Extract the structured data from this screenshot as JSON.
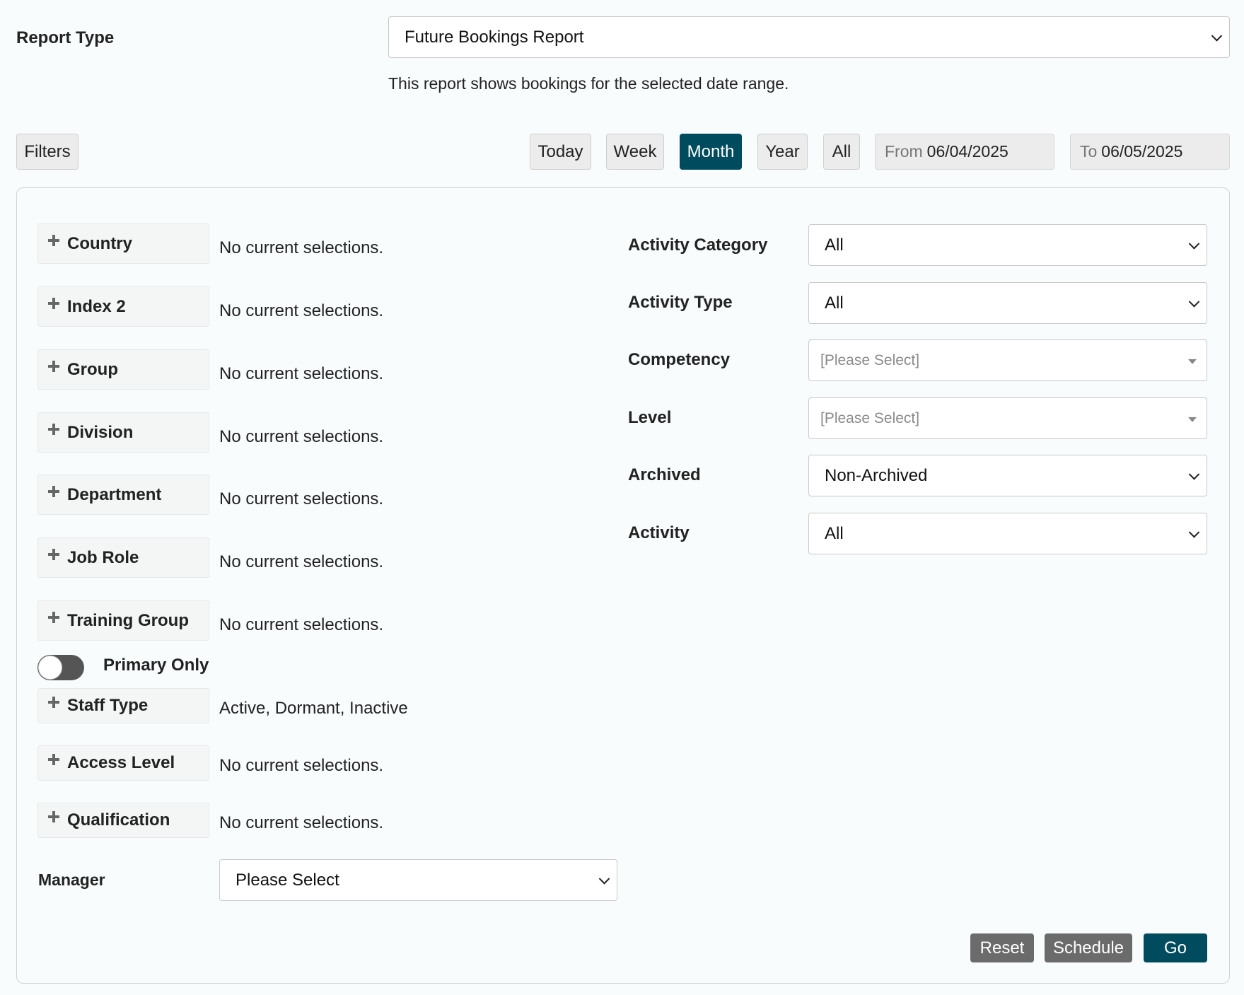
{
  "report_type": {
    "label": "Report Type",
    "value": "Future Bookings Report",
    "description": "This report shows bookings for the selected date range."
  },
  "toolbar": {
    "filters_label": "Filters",
    "ranges": [
      "Today",
      "Week",
      "Month",
      "Year",
      "All"
    ],
    "active_range": "Month",
    "from_prefix": "From",
    "from_value": "06/04/2025",
    "to_prefix": "To",
    "to_value": "06/05/2025"
  },
  "filters": [
    {
      "label": "Country",
      "selection": "No current selections."
    },
    {
      "label": "Index 2",
      "selection": "No current selections."
    },
    {
      "label": "Group",
      "selection": "No current selections."
    },
    {
      "label": "Division",
      "selection": "No current selections."
    },
    {
      "label": "Department",
      "selection": "No current selections."
    },
    {
      "label": "Job Role",
      "selection": "No current selections."
    },
    {
      "label": "Training Group",
      "selection": "No current selections."
    },
    {
      "label": "Staff Type",
      "selection": "Active, Dormant, Inactive"
    },
    {
      "label": "Access Level",
      "selection": "No current selections."
    },
    {
      "label": "Qualification",
      "selection": "No current selections."
    }
  ],
  "primary_only": {
    "label": "Primary Only",
    "on": false
  },
  "manager": {
    "label": "Manager",
    "value": "Please Select"
  },
  "right_fields": [
    {
      "label": "Activity Category",
      "value": "All"
    },
    {
      "label": "Activity Type",
      "value": "All"
    },
    {
      "label": "Competency",
      "value": "[Please Select]"
    },
    {
      "label": "Level",
      "value": "[Please Select]"
    },
    {
      "label": "Archived",
      "value": "Non-Archived"
    },
    {
      "label": "Activity",
      "value": "All"
    }
  ],
  "actions": {
    "reset": "Reset",
    "schedule": "Schedule",
    "go": "Go"
  },
  "colors": {
    "primary": "#004c5e",
    "secondary": "#6b6b6b"
  }
}
